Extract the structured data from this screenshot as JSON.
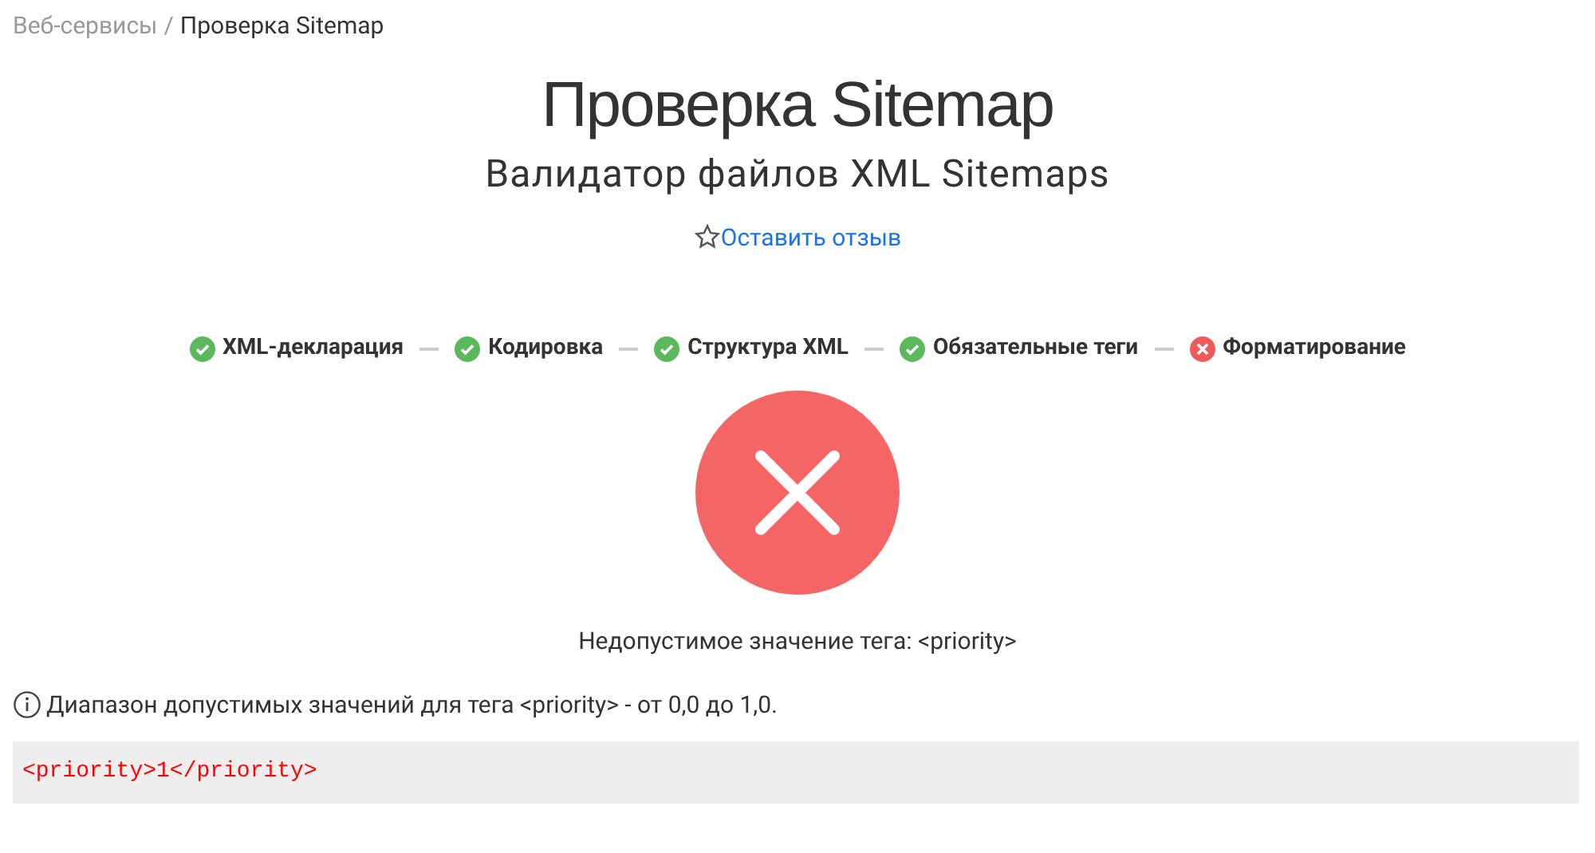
{
  "breadcrumb": [
    {
      "label": "Веб-сервисы",
      "current": false
    },
    {
      "label": "/",
      "current": false
    },
    {
      "label": "Проверка Sitemap",
      "current": true
    }
  ],
  "title": "Проверка Sitemap",
  "subtitle": "Валидатор файлов XML Sitemaps",
  "review_link": "Оставить отзыв",
  "steps": [
    {
      "label": "XML-декларация",
      "passed": true
    },
    {
      "label": "Кодировка",
      "passed": true
    },
    {
      "label": "Структура XML",
      "passed": true
    },
    {
      "label": "Обязательные теги",
      "passed": true
    },
    {
      "label": "Форматирование",
      "passed": false
    }
  ],
  "result": {
    "passed": false,
    "message": "Недопустимое значение тега: <priority>"
  },
  "hint": "Диапазон допустимых значений для тега <priority> - от 0,0 до 1,0.",
  "code": "<priority>1</priority>"
}
